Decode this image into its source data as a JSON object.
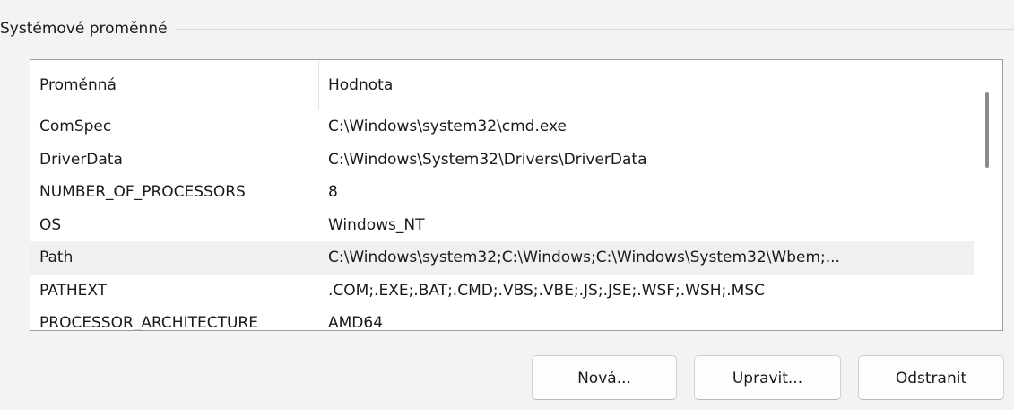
{
  "group": {
    "title": "Systémové proměnné"
  },
  "list": {
    "columns": [
      "Proměnná",
      "Hodnota"
    ],
    "rows": [
      {
        "name": "ComSpec",
        "value": "C:\\Windows\\system32\\cmd.exe"
      },
      {
        "name": "DriverData",
        "value": "C:\\Windows\\System32\\Drivers\\DriverData"
      },
      {
        "name": "NUMBER_OF_PROCESSORS",
        "value": "8"
      },
      {
        "name": "OS",
        "value": "Windows_NT"
      },
      {
        "name": "Path",
        "value": "C:\\Windows\\system32;C:\\Windows;C:\\Windows\\System32\\Wbem;..."
      },
      {
        "name": "PATHEXT",
        "value": ".COM;.EXE;.BAT;.CMD;.VBS;.VBE;.JS;.JSE;.WSF;.WSH;.MSC"
      },
      {
        "name": "PROCESSOR_ARCHITECTURE",
        "value": "AMD64"
      }
    ],
    "hovered_row": 4
  },
  "buttons": {
    "new_label": "Nová...",
    "edit_label": "Upravit...",
    "delete_label": "Odstranit"
  }
}
